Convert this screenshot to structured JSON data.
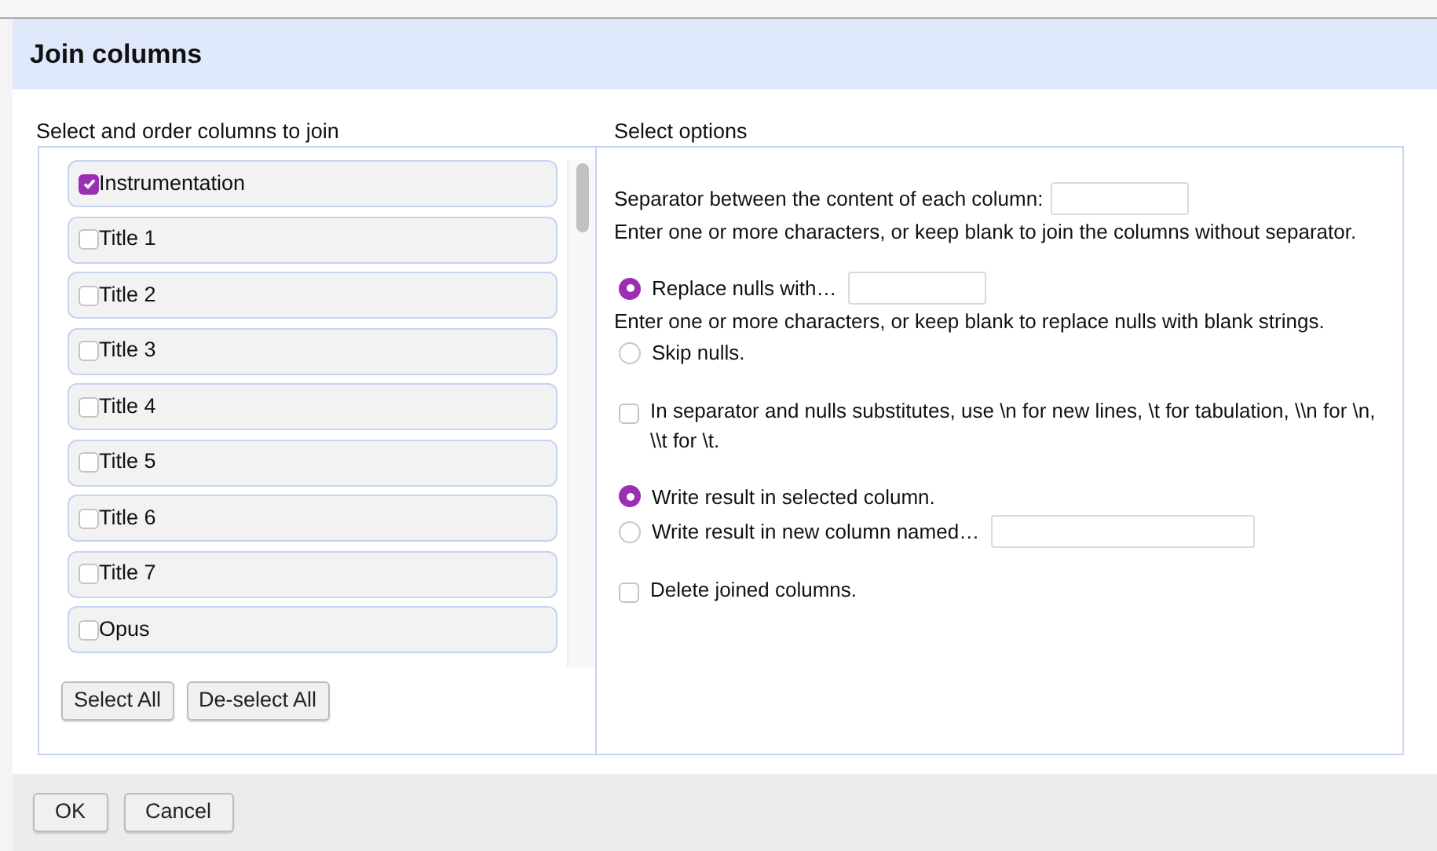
{
  "dialog": {
    "title": "Join columns"
  },
  "columns_panel": {
    "label": "Select and order columns to join",
    "items": [
      {
        "label": "Instrumentation",
        "checked": true
      },
      {
        "label": "Title 1",
        "checked": false
      },
      {
        "label": "Title 2",
        "checked": false
      },
      {
        "label": "Title 3",
        "checked": false
      },
      {
        "label": "Title 4",
        "checked": false
      },
      {
        "label": "Title 5",
        "checked": false
      },
      {
        "label": "Title 6",
        "checked": false
      },
      {
        "label": "Title 7",
        "checked": false
      },
      {
        "label": "Opus",
        "checked": false
      }
    ],
    "buttons": [
      "Select All",
      "De-select All"
    ]
  },
  "options_panel": {
    "label": "Select options",
    "groups": [
      [
        {
          "kind": "field",
          "label": "Separator between the content of each column:"
        },
        {
          "kind": "hint",
          "label": "Enter one or more characters, or keep blank to join the columns without separator."
        }
      ],
      [
        {
          "kind": "radio",
          "label": "Replace nulls with…",
          "selected": true,
          "field": true
        },
        {
          "kind": "hint",
          "label": "Enter one or more characters, or keep blank to replace nulls with blank strings."
        },
        {
          "kind": "radio",
          "label": "Skip nulls.",
          "selected": false,
          "field": false
        }
      ],
      [
        {
          "kind": "checkbox",
          "label": "In separator and nulls substitutes, use \\n for new lines, \\t for tabulation, \\\\n for \\n, \\\\t for \\t.",
          "checked": false
        }
      ],
      [
        {
          "kind": "radio",
          "label": "Write result in selected column.",
          "selected": true,
          "field": false
        },
        {
          "kind": "radio",
          "label": "Write result in new column named…",
          "selected": false,
          "field": true
        }
      ],
      [
        {
          "kind": "checkbox",
          "label": "Delete joined columns.",
          "checked": false
        }
      ]
    ]
  },
  "footer": {
    "buttons": [
      "OK",
      "Cancel"
    ]
  }
}
